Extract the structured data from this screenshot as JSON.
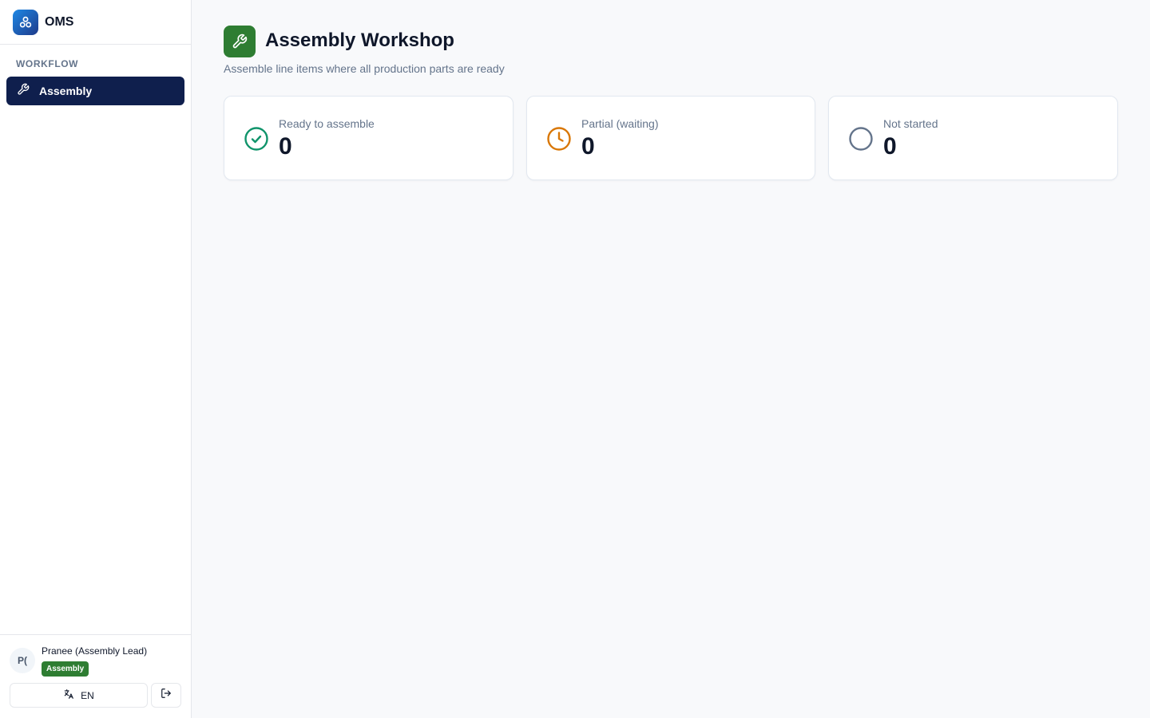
{
  "app": {
    "name": "OMS"
  },
  "sidebar": {
    "section_label": "WORKFLOW",
    "items": [
      {
        "label": "Assembly",
        "icon": "wrench-icon",
        "active": true
      }
    ]
  },
  "user": {
    "initials": "P(",
    "name": "Pranee (Assembly Lead)",
    "role": "Assembly",
    "language": "EN"
  },
  "page": {
    "title": "Assembly Workshop",
    "subtitle": "Assemble line items where all production parts are ready"
  },
  "stats": [
    {
      "label": "Ready to assemble",
      "value": "0",
      "icon": "check-circle-icon",
      "color": "#10946b"
    },
    {
      "label": "Partial (waiting)",
      "value": "0",
      "icon": "clock-icon",
      "color": "#d97706"
    },
    {
      "label": "Not started",
      "value": "0",
      "icon": "circle-icon",
      "color": "#64748b"
    }
  ],
  "colors": {
    "navy": "#0f1f4d",
    "green": "#2e7d32",
    "brand_blue": "#1e88e5"
  }
}
